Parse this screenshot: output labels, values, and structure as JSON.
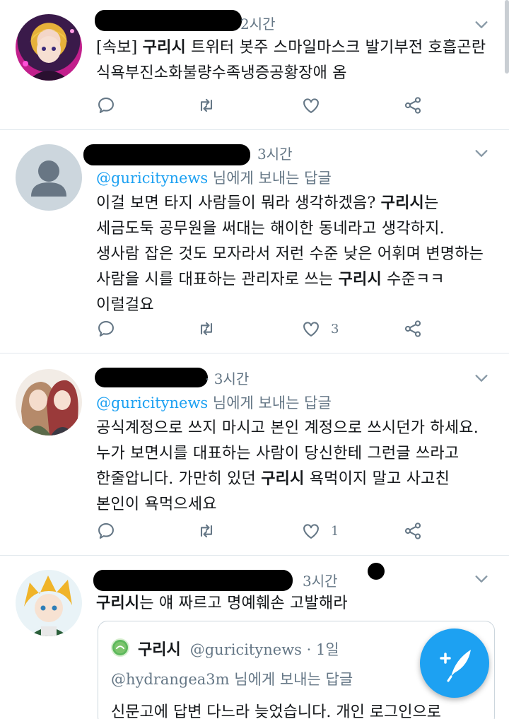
{
  "colors": {
    "accent": "#1da1f2",
    "muted": "#657786",
    "text": "#14171a",
    "border": "#e1e8ed"
  },
  "tweets": [
    {
      "time": "2시간",
      "lines": [
        [
          {
            "t": "[속보] ",
            "b": false
          },
          {
            "t": "구리시",
            "b": true
          },
          {
            "t": " 트위터 봇주 스마일마스크 발기부전 호흡곤란",
            "b": false
          }
        ],
        [
          {
            "t": "식욕부진소화불량수족냉증공황장애 옴",
            "b": false
          }
        ]
      ],
      "reply_count": "",
      "retweet_count": "",
      "like_count": ""
    },
    {
      "time": "3시간",
      "reply_handle": "@guricitynews",
      "reply_suffix": " 님에게 보내는 답글",
      "lines": [
        [
          {
            "t": "이걸 보면 타지 사람들이 뭐라 생각하겠음? ",
            "b": false
          },
          {
            "t": "구리시",
            "b": true
          },
          {
            "t": "는",
            "b": false
          }
        ],
        [
          {
            "t": "세금도둑 공무원을 써대는 해이한 동네라고 생각하지.",
            "b": false
          }
        ],
        [
          {
            "t": "생사람 잡은 것도 모자라서 저런 수준 낮은 어휘며 변명하는",
            "b": false
          }
        ],
        [
          {
            "t": "사람을 시를 대표하는 관리자로 쓰는 ",
            "b": false
          },
          {
            "t": "구리시",
            "b": true
          },
          {
            "t": " 수준ㅋㅋ",
            "b": false
          }
        ],
        [
          {
            "t": "이럴걸요",
            "b": false
          }
        ]
      ],
      "like_count": "3"
    },
    {
      "time": "· 3시간",
      "reply_handle": "@guricitynews",
      "reply_suffix": " 님에게 보내는 답글",
      "lines": [
        [
          {
            "t": "공식계정으로 쓰지 마시고 본인 계정으로 쓰시던가 하세요.",
            "b": false
          }
        ],
        [
          {
            "t": "누가 보면시를 대표하는 사람이 당신한테 그런글 쓰라고",
            "b": false
          }
        ],
        [
          {
            "t": "한줄압니다. 가만히 있던 ",
            "b": false
          },
          {
            "t": "구리시",
            "b": true
          },
          {
            "t": " 욕먹이지 말고 사고친",
            "b": false
          }
        ],
        [
          {
            "t": "본인이 욕먹으세요",
            "b": false
          }
        ]
      ],
      "like_count": "1"
    },
    {
      "time": "3시간",
      "lines": [
        [
          {
            "t": "구리시",
            "b": true
          },
          {
            "t": "는 얘 짜르고 명예훼손 고발해라",
            "b": false
          }
        ]
      ],
      "quote": {
        "name": "구리시",
        "handle": "@guricitynews · 1일",
        "reply_line": "@hydrangea3m 님에게 보내는 답글",
        "cut_text": "신문고에 답변 다느라 늦었습니다. 개인 로그인으로"
      }
    }
  ],
  "icons": {
    "caret": "chevron-down-icon",
    "reply": "reply-icon",
    "retweet": "retweet-icon",
    "like": "heart-icon",
    "share": "share-icon",
    "compose": "compose-tweet-icon"
  }
}
